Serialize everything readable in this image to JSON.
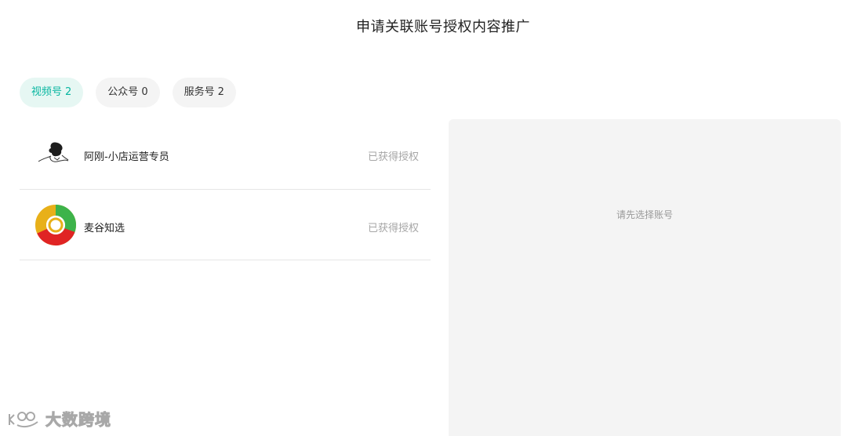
{
  "header": {
    "title": "申请关联账号授权内容推广"
  },
  "tabs": [
    {
      "label": "视频号",
      "count": "2",
      "active": true
    },
    {
      "label": "公众号",
      "count": "0",
      "active": false
    },
    {
      "label": "服务号",
      "count": "2",
      "active": false
    }
  ],
  "accounts": [
    {
      "name": "阿刚-小店运营专员",
      "status": "已获得授权",
      "avatar_icon": "sketch-person-avatar"
    },
    {
      "name": "麦谷知选",
      "status": "已获得授权",
      "avatar_icon": "colorful-ring-logo"
    }
  ],
  "detail": {
    "placeholder": "请先选择账号"
  },
  "watermark": {
    "text": "大数跨境"
  },
  "colors": {
    "accent": "#07b6a0",
    "active_tab_bg": "#e6f7f3",
    "panel_bg": "#f4f4f4",
    "muted_text": "#a6a6a6"
  }
}
